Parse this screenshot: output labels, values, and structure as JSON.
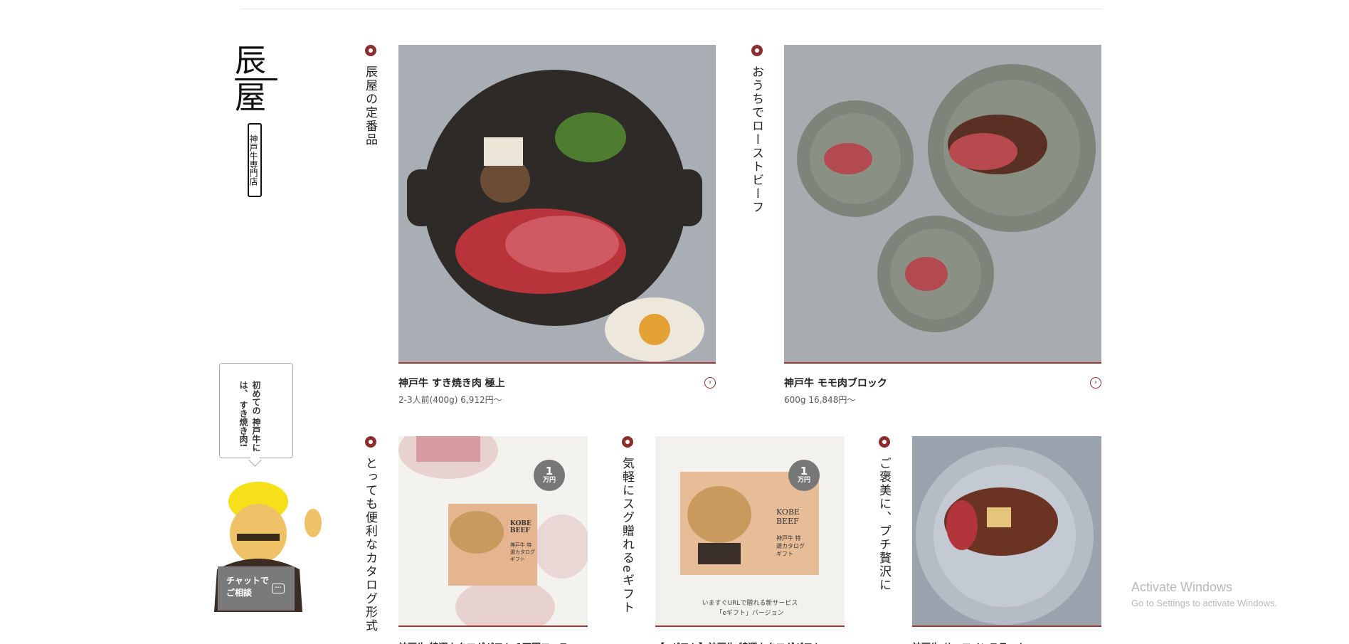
{
  "brand": {
    "logo_text": "辰屋",
    "shop_label": "神戸牛専門店"
  },
  "sections": [
    {
      "title": "辰屋の定番品",
      "product_name": "神戸牛 すき焼き肉 極上",
      "product_price": "2-3人前(400g) 6,912円〜"
    },
    {
      "title": "おうちでローストビーフ",
      "product_name": "神戸牛 モモ肉ブロック",
      "product_price": "600g 16,848円〜"
    },
    {
      "title": "とっても便利なカタログ形式"
    },
    {
      "title": "気軽にスグ贈れるeギフト"
    },
    {
      "title": "ご褒美に、プチ贅沢に"
    }
  ],
  "catalog": {
    "badge_number": "1",
    "badge_unit": "万円",
    "kobe_beef": "KOBE BEEF",
    "card_text": "神戸牛 特選カタログ ギフト",
    "egift_caption_1": "いますぐURLで贈れる新サービス",
    "egift_caption_2": "「eギフト」バージョン"
  },
  "chat": {
    "bubble_text": "初めての 神戸牛には、 すき焼き肉!",
    "button_text": "チャットで\nご相談",
    "icon": "chat-bubble-icon"
  },
  "watermark": {
    "line1": "Activate Windows",
    "line2": "Go to Settings to activate Windows."
  },
  "icons": {
    "arrow": "arrow-right-circle-icon",
    "dot": "flower-dot-icon"
  },
  "colors": {
    "accent": "#8a2e2e",
    "gray_badge": "#777777"
  }
}
